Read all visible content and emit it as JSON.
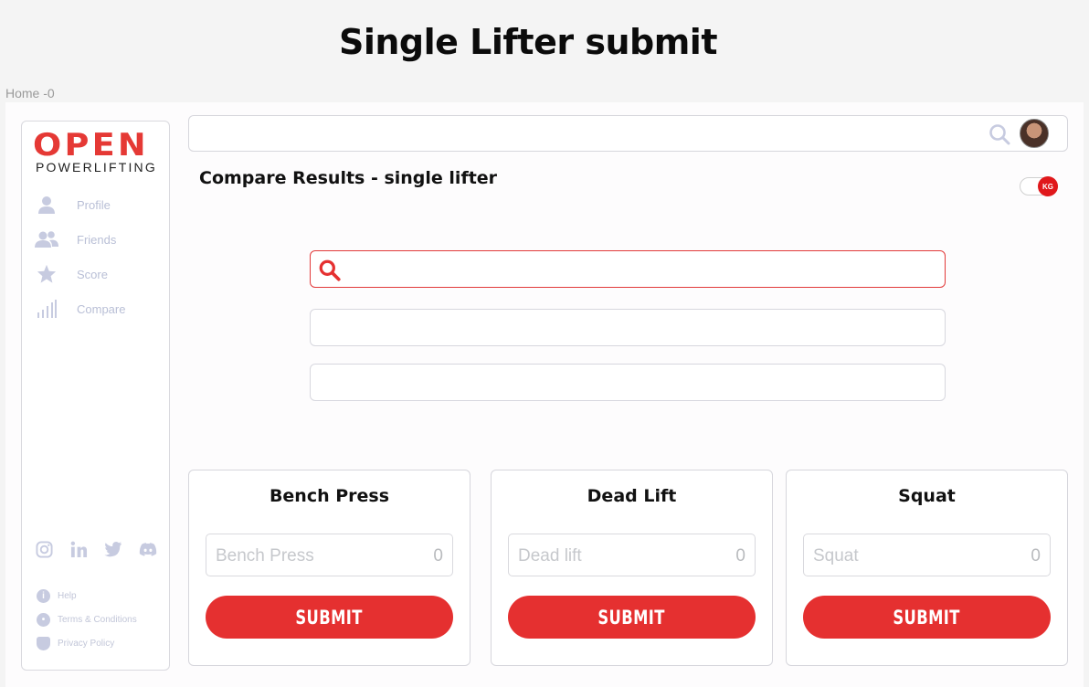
{
  "page": {
    "title": "Single Lifter submit",
    "frame_label": "Home -0"
  },
  "logo": {
    "main": "OPEN",
    "sub": "POWERLIFTING"
  },
  "sidebar": {
    "items": [
      {
        "label": "Profile",
        "icon": "user-icon"
      },
      {
        "label": "Friends",
        "icon": "friends-icon"
      },
      {
        "label": "Score",
        "icon": "star-icon"
      },
      {
        "label": "Compare",
        "icon": "bar-chart-icon"
      }
    ],
    "socials": [
      "instagram-icon",
      "linkedin-icon",
      "twitter-icon",
      "discord-icon"
    ],
    "links": [
      {
        "label": "Help",
        "icon": "info-icon"
      },
      {
        "label": "Terms & Conditions",
        "icon": "terms-icon"
      },
      {
        "label": "Privacy Policy",
        "icon": "shield-icon"
      }
    ]
  },
  "main": {
    "section_title": "Compare Results - single lifter",
    "unit_toggle": {
      "label": "KG"
    }
  },
  "cards": [
    {
      "title": "Bench Press",
      "placeholder": "Bench Press",
      "value": "0",
      "button": "SUBMIT"
    },
    {
      "title": "Dead Lift",
      "placeholder": "Dead lift",
      "value": "0",
      "button": "SUBMIT"
    },
    {
      "title": "Squat",
      "placeholder": "Squat",
      "value": "0",
      "button": "SUBMIT"
    }
  ],
  "colors": {
    "accent": "#e53030",
    "muted_icon": "#c7cbe0"
  }
}
